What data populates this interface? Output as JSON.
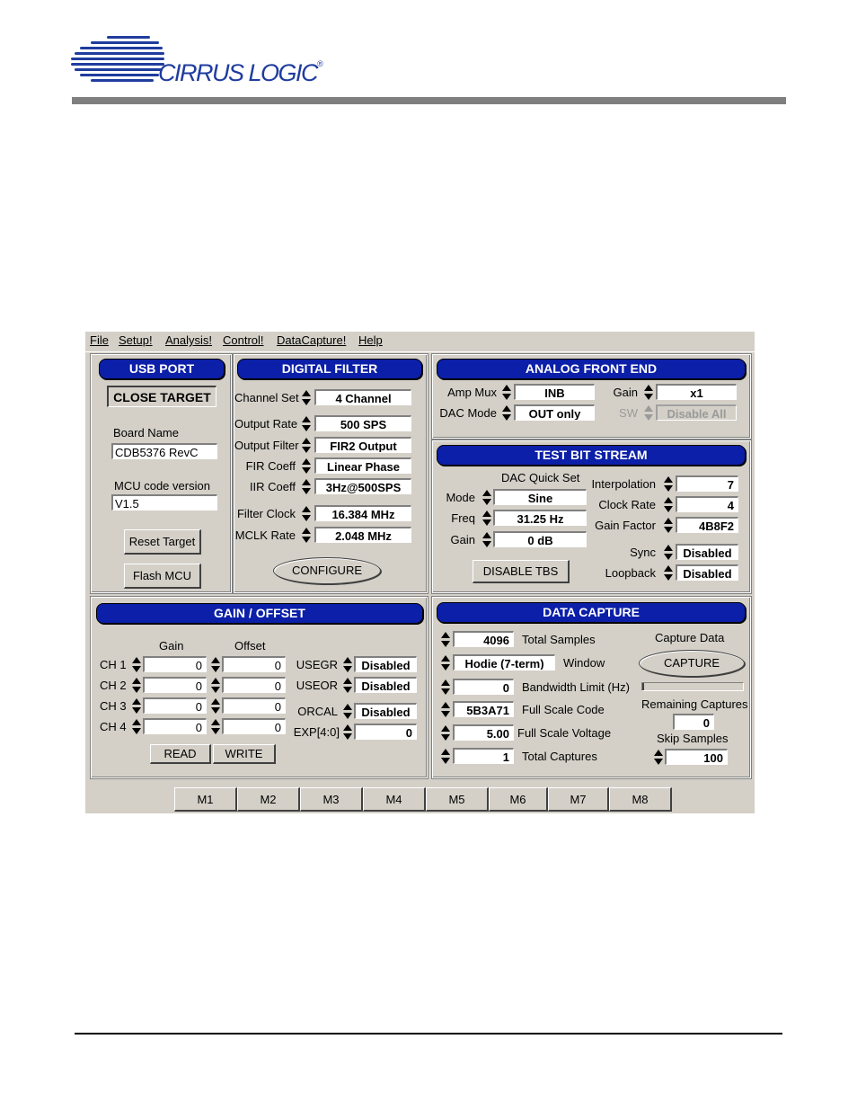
{
  "header": {
    "brand": "CIRRUS LOGIC",
    "trademark": "®",
    "brand_color": "#1f3c9e"
  },
  "window": {
    "menu": [
      "File",
      "Setup!",
      "Analysis!",
      "Control!",
      "DataCapture!",
      "Help"
    ],
    "usb_port": {
      "title": "USB PORT",
      "close_target": "CLOSE TARGET",
      "board_name_label": "Board Name",
      "board_name": "CDB5376 RevC",
      "mcu_version_label": "MCU code version",
      "mcu_version": "V1.5",
      "reset_target": "Reset Target",
      "flash_mcu": "Flash MCU"
    },
    "digital_filter": {
      "title": "DIGITAL FILTER",
      "rows": [
        {
          "label": "Channel Set",
          "value": "4 Channel"
        },
        {
          "label": "Output Rate",
          "value": "500 SPS"
        },
        {
          "label": "Output Filter",
          "value": "FIR2 Output"
        },
        {
          "label": "FIR Coeff",
          "value": "Linear Phase"
        },
        {
          "label": "IIR Coeff",
          "value": "3Hz@500SPS"
        },
        {
          "label": "Filter Clock",
          "value": "16.384 MHz"
        },
        {
          "label": "MCLK Rate",
          "value": "2.048 MHz"
        }
      ],
      "configure": "CONFIGURE"
    },
    "analog_front_end": {
      "title": "ANALOG FRONT END",
      "amp_mux_label": "Amp Mux",
      "amp_mux": "INB",
      "dac_mode_label": "DAC Mode",
      "dac_mode": "OUT only",
      "gain_label": "Gain",
      "gain": "x1",
      "sw_label": "SW",
      "sw": "Disable All"
    },
    "test_bit_stream": {
      "title": "TEST BIT STREAM",
      "dac_quick_set": "DAC Quick Set",
      "mode_label": "Mode",
      "mode": "Sine",
      "freq_label": "Freq",
      "freq": "31.25 Hz",
      "gain_label": "Gain",
      "gain": "0 dB",
      "interpolation_label": "Interpolation",
      "interpolation": "7",
      "clock_rate_label": "Clock Rate",
      "clock_rate": "4",
      "gain_factor_label": "Gain Factor",
      "gain_factor": "4B8F2",
      "sync_label": "Sync",
      "sync": "Disabled",
      "loopback_label": "Loopback",
      "loopback": "Disabled",
      "disable_tbs": "DISABLE TBS"
    },
    "gain_offset": {
      "title": "GAIN / OFFSET",
      "gain_header": "Gain",
      "offset_header": "Offset",
      "channels": [
        {
          "label": "CH 1",
          "gain": "0",
          "offset": "0"
        },
        {
          "label": "CH 2",
          "gain": "0",
          "offset": "0"
        },
        {
          "label": "CH 3",
          "gain": "0",
          "offset": "0"
        },
        {
          "label": "CH 4",
          "gain": "0",
          "offset": "0"
        }
      ],
      "usegr_label": "USEGR",
      "usegr": "Disabled",
      "useor_label": "USEOR",
      "useor": "Disabled",
      "orcal_label": "ORCAL",
      "orcal": "Disabled",
      "exp_label": "EXP[4:0]",
      "exp": "0",
      "read": "READ",
      "write": "WRITE"
    },
    "data_capture": {
      "title": "DATA CAPTURE",
      "total_samples": "4096",
      "total_samples_label": "Total Samples",
      "window": "Hodie (7-term)",
      "window_label": "Window",
      "bandwidth_limit": "0",
      "bandwidth_limit_label": "Bandwidth Limit (Hz)",
      "full_scale_code": "5B3A71",
      "full_scale_code_label": "Full Scale Code",
      "full_scale_voltage": "5.00",
      "full_scale_voltage_label": "Full Scale Voltage",
      "total_captures": "1",
      "total_captures_label": "Total Captures",
      "capture_data_label": "Capture Data",
      "capture": "CAPTURE",
      "capture_progress": 0.02,
      "remaining_captures_label": "Remaining Captures",
      "remaining_captures": "0",
      "skip_samples_label": "Skip Samples",
      "skip_samples": "100"
    },
    "macros": [
      "M1",
      "M2",
      "M3",
      "M4",
      "M5",
      "M6",
      "M7",
      "M8"
    ]
  }
}
